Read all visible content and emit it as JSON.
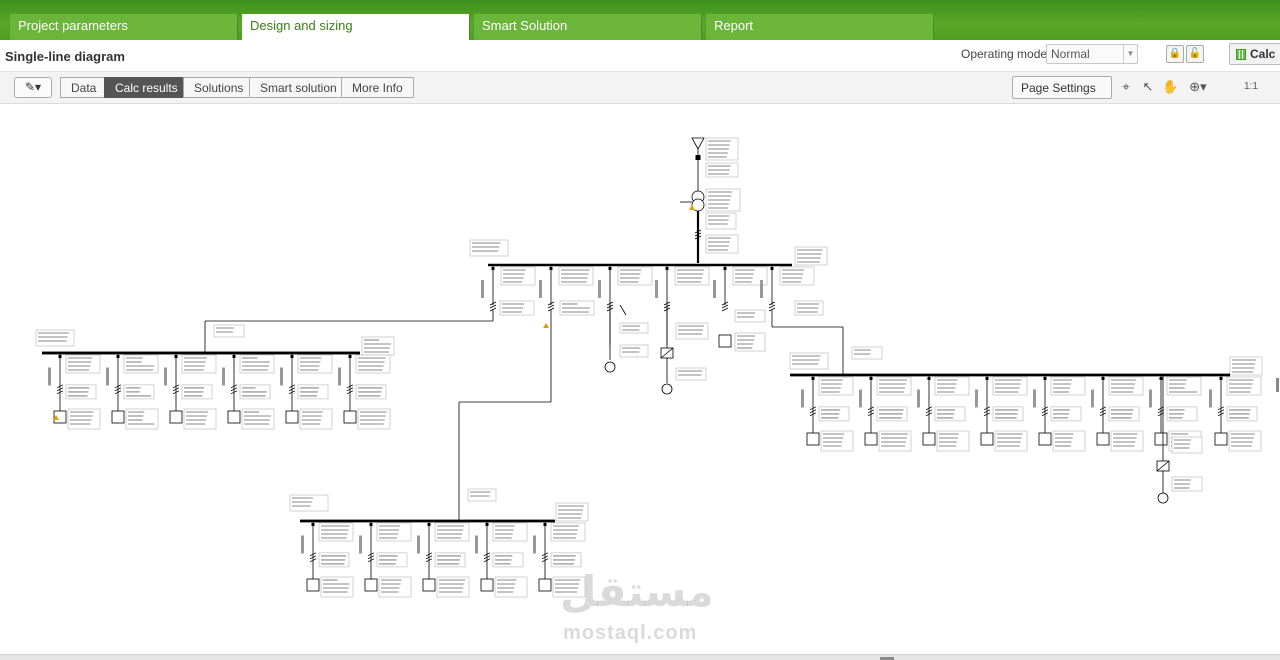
{
  "tabs": [
    {
      "label": "Project parameters",
      "active": false
    },
    {
      "label": "Design and sizing",
      "active": true
    },
    {
      "label": "Smart Solution",
      "active": false
    },
    {
      "label": "Report",
      "active": false
    }
  ],
  "page_title": "Single-line diagram",
  "operating_mode": {
    "label": "Operating mode",
    "value": "Normal"
  },
  "calc_button": "Calc",
  "view_tabs": [
    {
      "label": "Data",
      "active": false
    },
    {
      "label": "Calc results",
      "active": true
    },
    {
      "label": "Solutions",
      "active": false
    },
    {
      "label": "Smart solution",
      "active": false
    },
    {
      "label": "More Info",
      "active": false
    }
  ],
  "page_settings": "Page Settings",
  "zoom_ratio": "1:1",
  "icons": {
    "lock": "lock-icon",
    "unlock": "unlock-icon",
    "pen": "pen-icon",
    "frame": "frame-icon",
    "select": "select-icon",
    "pan": "hand-icon",
    "zoom": "zoom-in-icon"
  },
  "colors": {
    "tab_green": "#5aa82a",
    "active_tab_text": "#3a7f17",
    "busbar": "#000000",
    "warning": "#e0a000"
  },
  "watermark": {
    "arabic": "مستقل",
    "latin": "mostaql.com"
  }
}
